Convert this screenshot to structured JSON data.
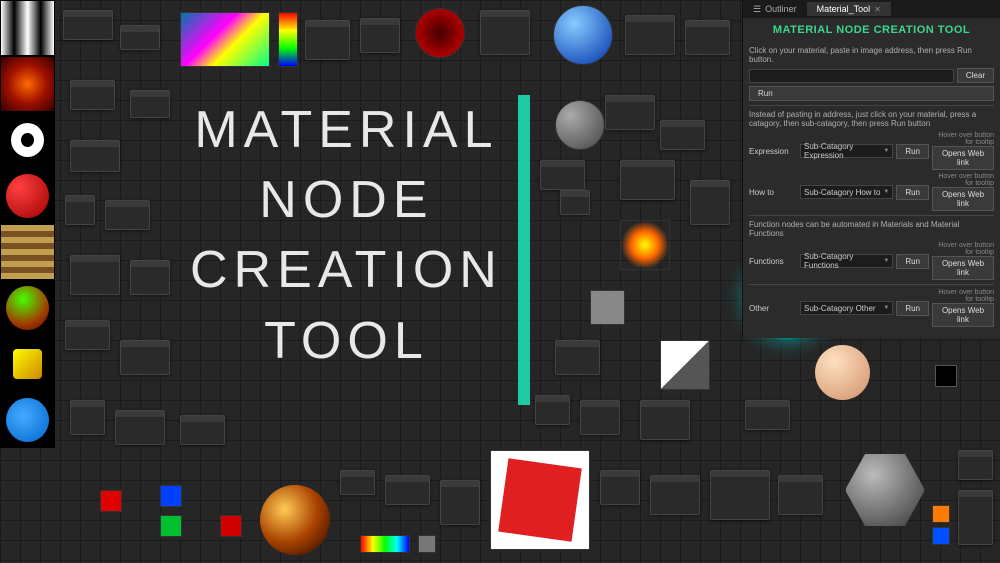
{
  "title": {
    "line1": "MATERIAL",
    "line2": "NODE",
    "line3": "CREATION",
    "line4": "TOOL"
  },
  "panel": {
    "tab_outliner": "Outliner",
    "tab_material": "Material_Tool",
    "title": "MATERIAL NODE CREATION TOOL",
    "instr1": "Click on your material, paste in image address, then press Run button.",
    "clear": "Clear",
    "run": "Run",
    "instr2": "Instead of pasting in address, just click on your material, press a catagory, then sub-catagory, then press Run button",
    "expression": "Expression",
    "sub_expression": "Sub-Catagory Expression",
    "howto": "How to",
    "sub_howto": "Sub-Catagory How to",
    "opens": "Opens Web link",
    "hover": "Hover over button for tooltip",
    "instr3": "Function nodes can be automated in Materials and Material Functions",
    "functions": "Functions",
    "sub_functions": "Sub-Catagory Functions",
    "other": "Other",
    "sub_other": "Sub-Catagory Other"
  },
  "thumbnails": [
    "gradient",
    "fire",
    "ring",
    "redsphere",
    "stripes",
    "greensphere",
    "yellowdot",
    "bluecircle"
  ]
}
